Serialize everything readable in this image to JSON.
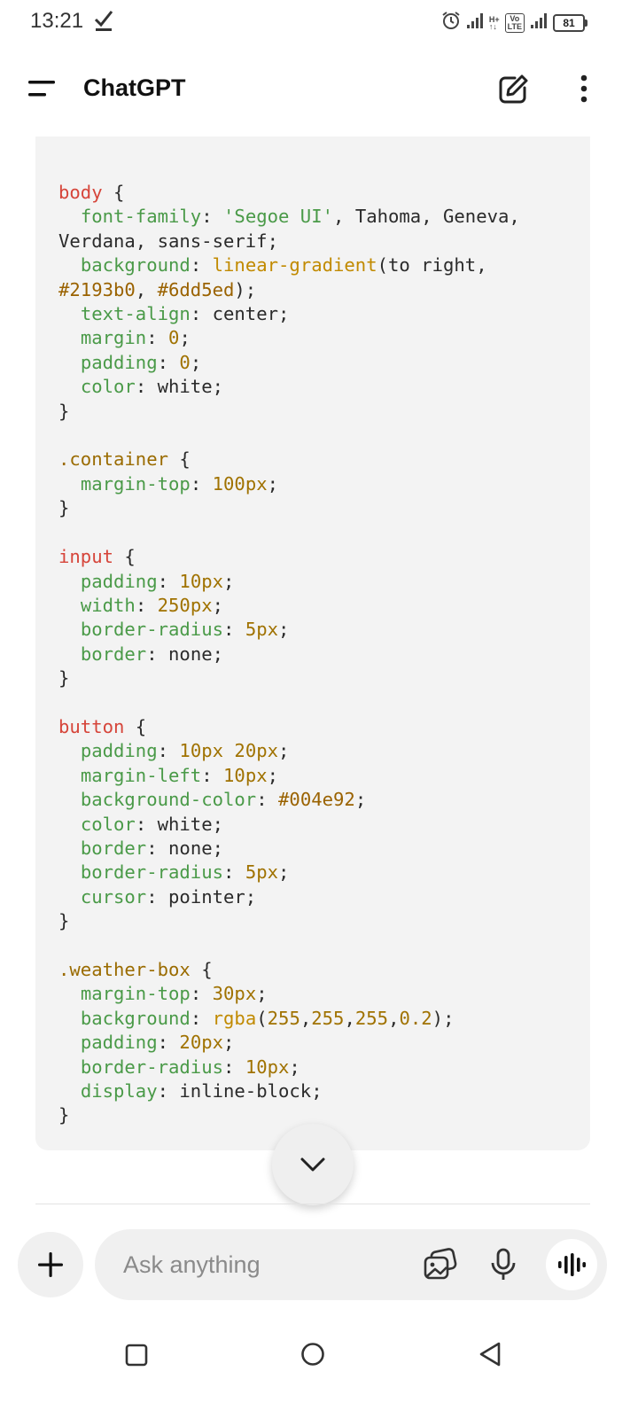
{
  "status_bar": {
    "time": "13:21",
    "hplus": "H+",
    "volte_top": "Vo",
    "volte_bottom": "LTE",
    "battery": "81"
  },
  "header": {
    "title": "ChatGPT"
  },
  "composer": {
    "placeholder": "Ask anything"
  },
  "colors": {
    "code_background": "#f3f3f3",
    "selector": "#d6453a",
    "property": "#4a9a48",
    "number": "#a07200"
  },
  "code_lines": [
    [
      {
        "t": "sel",
        "v": "body"
      },
      {
        "t": "",
        "v": " {"
      }
    ],
    [
      {
        "t": "",
        "v": "  "
      },
      {
        "t": "prop",
        "v": "font-family"
      },
      {
        "t": "",
        "v": ": "
      },
      {
        "t": "str",
        "v": "'Segoe UI'"
      },
      {
        "t": "",
        "v": ", Tahoma, Geneva,"
      }
    ],
    [
      {
        "t": "",
        "v": "Verdana, sans-serif;"
      }
    ],
    [
      {
        "t": "",
        "v": "  "
      },
      {
        "t": "prop",
        "v": "background"
      },
      {
        "t": "",
        "v": ": "
      },
      {
        "t": "fn",
        "v": "linear-gradient"
      },
      {
        "t": "",
        "v": "(to right,"
      }
    ],
    [
      {
        "t": "hex",
        "v": "#2193b0"
      },
      {
        "t": "",
        "v": ", "
      },
      {
        "t": "hex",
        "v": "#6dd5ed"
      },
      {
        "t": "",
        "v": ");"
      }
    ],
    [
      {
        "t": "",
        "v": "  "
      },
      {
        "t": "prop",
        "v": "text-align"
      },
      {
        "t": "",
        "v": ": center;"
      }
    ],
    [
      {
        "t": "",
        "v": "  "
      },
      {
        "t": "prop",
        "v": "margin"
      },
      {
        "t": "",
        "v": ": "
      },
      {
        "t": "num",
        "v": "0"
      },
      {
        "t": "",
        "v": ";"
      }
    ],
    [
      {
        "t": "",
        "v": "  "
      },
      {
        "t": "prop",
        "v": "padding"
      },
      {
        "t": "",
        "v": ": "
      },
      {
        "t": "num",
        "v": "0"
      },
      {
        "t": "",
        "v": ";"
      }
    ],
    [
      {
        "t": "",
        "v": "  "
      },
      {
        "t": "prop",
        "v": "color"
      },
      {
        "t": "",
        "v": ": white;"
      }
    ],
    [
      {
        "t": "",
        "v": "}"
      }
    ],
    [],
    [
      {
        "t": "cls",
        "v": ".container"
      },
      {
        "t": "",
        "v": " {"
      }
    ],
    [
      {
        "t": "",
        "v": "  "
      },
      {
        "t": "prop",
        "v": "margin-top"
      },
      {
        "t": "",
        "v": ": "
      },
      {
        "t": "num",
        "v": "100px"
      },
      {
        "t": "",
        "v": ";"
      }
    ],
    [
      {
        "t": "",
        "v": "}"
      }
    ],
    [],
    [
      {
        "t": "sel",
        "v": "input"
      },
      {
        "t": "",
        "v": " {"
      }
    ],
    [
      {
        "t": "",
        "v": "  "
      },
      {
        "t": "prop",
        "v": "padding"
      },
      {
        "t": "",
        "v": ": "
      },
      {
        "t": "num",
        "v": "10px"
      },
      {
        "t": "",
        "v": ";"
      }
    ],
    [
      {
        "t": "",
        "v": "  "
      },
      {
        "t": "prop",
        "v": "width"
      },
      {
        "t": "",
        "v": ": "
      },
      {
        "t": "num",
        "v": "250px"
      },
      {
        "t": "",
        "v": ";"
      }
    ],
    [
      {
        "t": "",
        "v": "  "
      },
      {
        "t": "prop",
        "v": "border-radius"
      },
      {
        "t": "",
        "v": ": "
      },
      {
        "t": "num",
        "v": "5px"
      },
      {
        "t": "",
        "v": ";"
      }
    ],
    [
      {
        "t": "",
        "v": "  "
      },
      {
        "t": "prop",
        "v": "border"
      },
      {
        "t": "",
        "v": ": none;"
      }
    ],
    [
      {
        "t": "",
        "v": "}"
      }
    ],
    [],
    [
      {
        "t": "sel",
        "v": "button"
      },
      {
        "t": "",
        "v": " {"
      }
    ],
    [
      {
        "t": "",
        "v": "  "
      },
      {
        "t": "prop",
        "v": "padding"
      },
      {
        "t": "",
        "v": ": "
      },
      {
        "t": "num",
        "v": "10px 20px"
      },
      {
        "t": "",
        "v": ";"
      }
    ],
    [
      {
        "t": "",
        "v": "  "
      },
      {
        "t": "prop",
        "v": "margin-left"
      },
      {
        "t": "",
        "v": ": "
      },
      {
        "t": "num",
        "v": "10px"
      },
      {
        "t": "",
        "v": ";"
      }
    ],
    [
      {
        "t": "",
        "v": "  "
      },
      {
        "t": "prop",
        "v": "background-color"
      },
      {
        "t": "",
        "v": ": "
      },
      {
        "t": "hex",
        "v": "#004e92"
      },
      {
        "t": "",
        "v": ";"
      }
    ],
    [
      {
        "t": "",
        "v": "  "
      },
      {
        "t": "prop",
        "v": "color"
      },
      {
        "t": "",
        "v": ": white;"
      }
    ],
    [
      {
        "t": "",
        "v": "  "
      },
      {
        "t": "prop",
        "v": "border"
      },
      {
        "t": "",
        "v": ": none;"
      }
    ],
    [
      {
        "t": "",
        "v": "  "
      },
      {
        "t": "prop",
        "v": "border-radius"
      },
      {
        "t": "",
        "v": ": "
      },
      {
        "t": "num",
        "v": "5px"
      },
      {
        "t": "",
        "v": ";"
      }
    ],
    [
      {
        "t": "",
        "v": "  "
      },
      {
        "t": "prop",
        "v": "cursor"
      },
      {
        "t": "",
        "v": ": pointer;"
      }
    ],
    [
      {
        "t": "",
        "v": "}"
      }
    ],
    [],
    [
      {
        "t": "cls",
        "v": ".weather-box"
      },
      {
        "t": "",
        "v": " {"
      }
    ],
    [
      {
        "t": "",
        "v": "  "
      },
      {
        "t": "prop",
        "v": "margin-top"
      },
      {
        "t": "",
        "v": ": "
      },
      {
        "t": "num",
        "v": "30px"
      },
      {
        "t": "",
        "v": ";"
      }
    ],
    [
      {
        "t": "",
        "v": "  "
      },
      {
        "t": "prop",
        "v": "background"
      },
      {
        "t": "",
        "v": ": "
      },
      {
        "t": "fn",
        "v": "rgba"
      },
      {
        "t": "",
        "v": "("
      },
      {
        "t": "num",
        "v": "255"
      },
      {
        "t": "",
        "v": ","
      },
      {
        "t": "num",
        "v": "255"
      },
      {
        "t": "",
        "v": ","
      },
      {
        "t": "num",
        "v": "255"
      },
      {
        "t": "",
        "v": ","
      },
      {
        "t": "num",
        "v": "0.2"
      },
      {
        "t": "",
        "v": ");"
      }
    ],
    [
      {
        "t": "",
        "v": "  "
      },
      {
        "t": "prop",
        "v": "padding"
      },
      {
        "t": "",
        "v": ": "
      },
      {
        "t": "num",
        "v": "20px"
      },
      {
        "t": "",
        "v": ";"
      }
    ],
    [
      {
        "t": "",
        "v": "  "
      },
      {
        "t": "prop",
        "v": "border-radius"
      },
      {
        "t": "",
        "v": ": "
      },
      {
        "t": "num",
        "v": "10px"
      },
      {
        "t": "",
        "v": ";"
      }
    ],
    [
      {
        "t": "",
        "v": "  "
      },
      {
        "t": "prop",
        "v": "display"
      },
      {
        "t": "",
        "v": ": inline-block;"
      }
    ],
    [
      {
        "t": "",
        "v": "}"
      }
    ]
  ]
}
